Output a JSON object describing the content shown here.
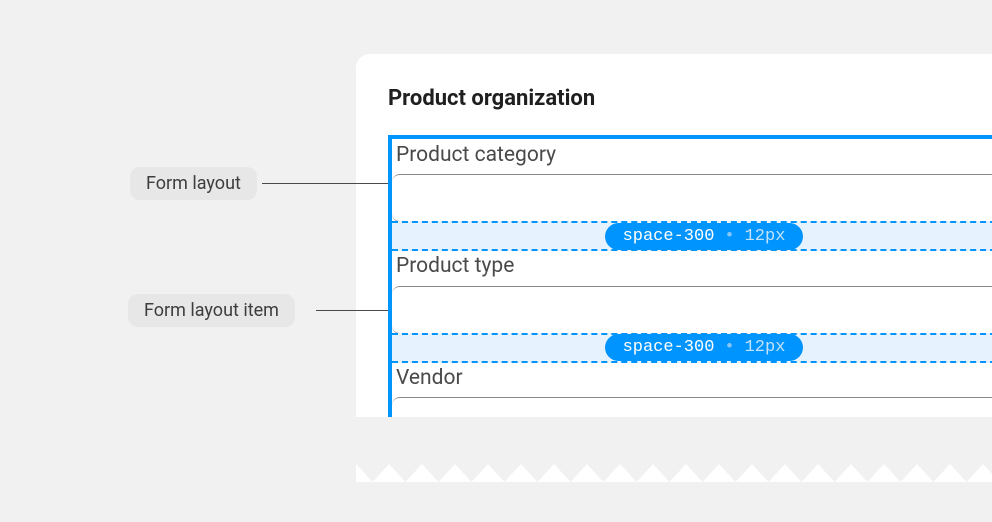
{
  "card": {
    "title": "Product organization"
  },
  "fields": {
    "field1_label": "Product category",
    "field2_label": "Product type",
    "field3_label": "Vendor"
  },
  "spacer": {
    "token": "space-300",
    "value": "12px"
  },
  "annotations": {
    "form_layout": "Form layout",
    "form_layout_item": "Form layout item"
  }
}
